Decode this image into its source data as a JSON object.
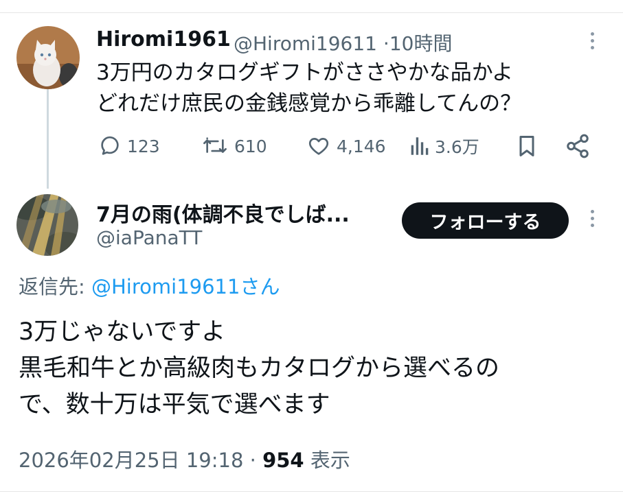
{
  "parent_tweet": {
    "display_name": "Hiromi1961",
    "handle": "@Hiromi19611",
    "separator": "·",
    "time_ago": "10時間",
    "text_lines": [
      "3万円のカタログギフトがささやかな品かよ",
      "どれだけ庶民の金銭感覚から乖離してんの？"
    ],
    "actions": {
      "replies": "123",
      "reposts": "610",
      "likes": "4,146",
      "views": "3.6万"
    },
    "avatar_icon": "cat-photo-avatar"
  },
  "reply_tweet": {
    "display_name": "7月の雨(体調不良でしば...",
    "handle": "@iaPanaTT",
    "follow_label": "フォローする",
    "reply_to_prefix": "返信先:",
    "reply_to_user": "@Hiromi19611さん",
    "text_lines": [
      "3万じゃないですよ",
      "黒毛和牛とか高級肉もカタログから選べるの",
      "で、数十万は平気で選べます"
    ],
    "timestamp": "2026年02月25日 19:18",
    "separator": "·",
    "view_count": "954",
    "view_label": "表示",
    "avatar_icon": "sunlight-clouds-avatar"
  },
  "colors": {
    "text": "#0f1419",
    "secondary": "#536471",
    "link": "#1d9bf0",
    "divider": "#e6e6e6",
    "follow_button_bg": "#0f1419"
  }
}
